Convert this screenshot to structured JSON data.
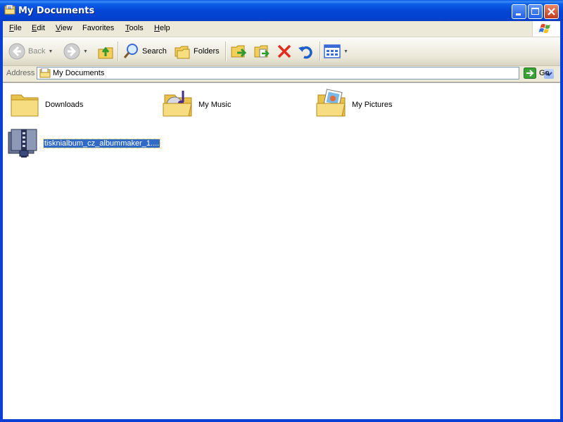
{
  "window": {
    "title": "My Documents"
  },
  "menu": [
    {
      "label": "File",
      "key": "F"
    },
    {
      "label": "Edit",
      "key": "E"
    },
    {
      "label": "View",
      "key": "V"
    },
    {
      "label": "Favorites",
      "key": "a"
    },
    {
      "label": "Tools",
      "key": "T"
    },
    {
      "label": "Help",
      "key": "H"
    }
  ],
  "toolbar": {
    "back_label": "Back",
    "search_label": "Search",
    "folders_label": "Folders"
  },
  "address": {
    "label": "Address",
    "value": "My Documents",
    "go_label": "Go"
  },
  "items": [
    {
      "name": "Downloads",
      "icon": "folder-icon"
    },
    {
      "name": "My Music",
      "icon": "music-folder-icon"
    },
    {
      "name": "My Pictures",
      "icon": "pictures-folder-icon"
    },
    {
      "name": "tisknialbum_cz_albummaker_1....",
      "icon": "zip-archive-icon",
      "selected": true
    }
  ]
}
